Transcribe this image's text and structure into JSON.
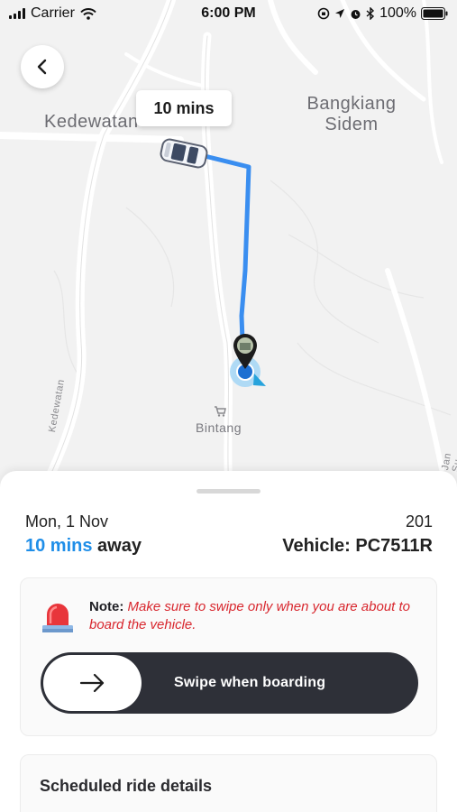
{
  "status_bar": {
    "carrier": "Carrier",
    "time": "6:00 PM",
    "battery": "100%"
  },
  "map": {
    "eta_bubble": "10 mins",
    "places": {
      "kedewatan": "Kedewatan",
      "bangkiang_line1": "Bangkiang",
      "bangkiang_line2": "Sidem",
      "bintang": "Bintang",
      "road_left": "Kedewatan",
      "road_right": "Jan Su"
    },
    "route_color": "#3a8ef0"
  },
  "trip": {
    "date": "Mon, 1 Nov",
    "route_number": "201",
    "eta_value": "10 mins",
    "eta_suffix": "away",
    "vehicle": "Vehicle: PC7511R",
    "accent_color": "#1f8ee8"
  },
  "note": {
    "label": "Note:",
    "text": "Make sure to swipe only when you are about to board the vehicle.",
    "icon": "siren-icon"
  },
  "swipe": {
    "label": "Swipe when boarding",
    "icon": "arrow-right-icon"
  },
  "details": {
    "title": "Scheduled ride details"
  }
}
